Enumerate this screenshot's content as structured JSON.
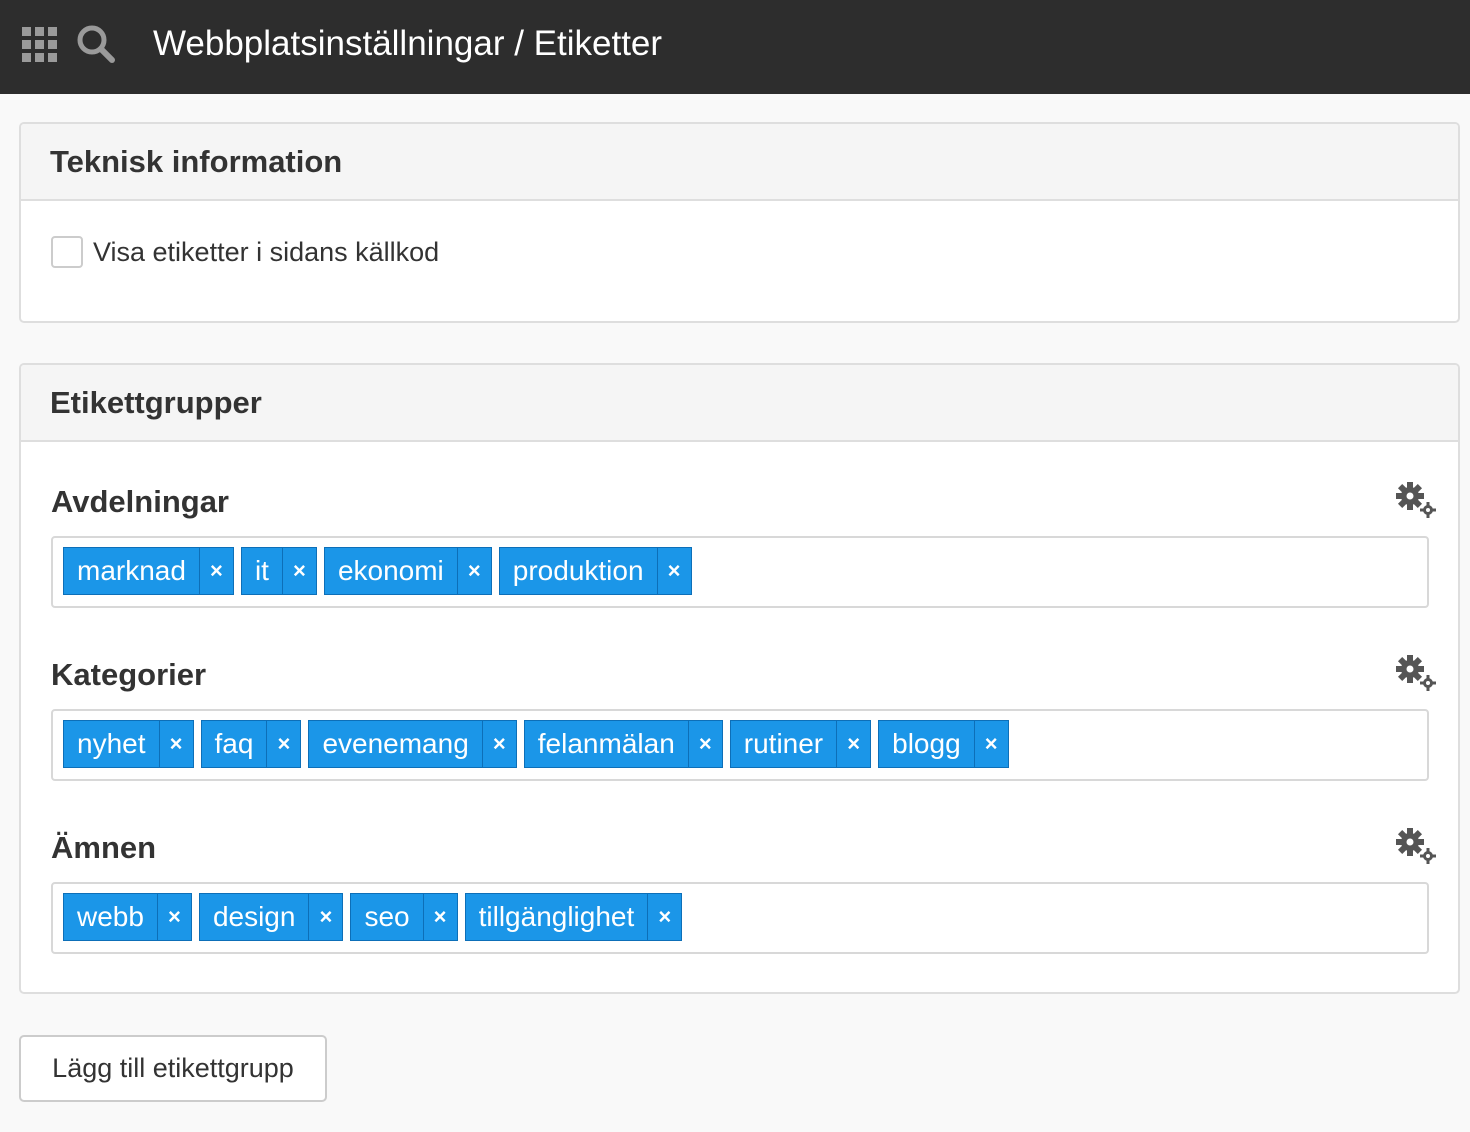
{
  "header": {
    "title": "Webbplatsinställningar / Etiketter"
  },
  "technical": {
    "title": "Teknisk information",
    "checkbox_label": "Visa etiketter i sidans källkod",
    "checked": false
  },
  "groups_panel": {
    "title": "Etikettgrupper",
    "groups": [
      {
        "title": "Avdelningar",
        "tags": [
          "marknad",
          "it",
          "ekonomi",
          "produktion"
        ]
      },
      {
        "title": "Kategorier",
        "tags": [
          "nyhet",
          "faq",
          "evenemang",
          "felanmälan",
          "rutiner",
          "blogg"
        ]
      },
      {
        "title": "Ämnen",
        "tags": [
          "webb",
          "design",
          "seo",
          "tillgänglighet"
        ]
      }
    ]
  },
  "tag_remove_symbol": "×",
  "add_group_button": "Lägg till etikettgrupp",
  "colors": {
    "topbar": "#2d2d2d",
    "tag": "#1b96e8",
    "tag_border": "#0d6fb8"
  },
  "icons": {
    "apps": "grid-icon",
    "search": "search-icon",
    "settings": "gears-icon"
  }
}
